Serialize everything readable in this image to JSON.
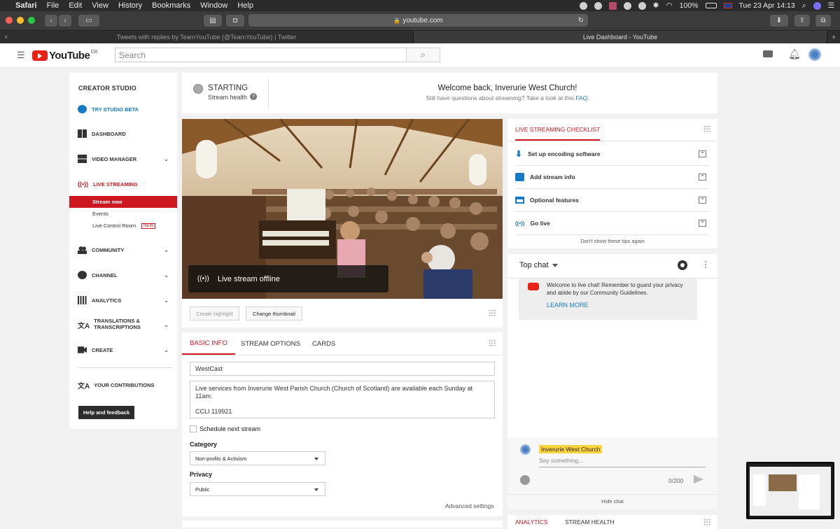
{
  "menubar": {
    "apple": "",
    "app": "Safari",
    "menus": [
      "File",
      "Edit",
      "View",
      "History",
      "Bookmarks",
      "Window",
      "Help"
    ],
    "battery": "100%",
    "datetime": "Tue 23 Apr  14:13"
  },
  "browser": {
    "url": "youtube.com",
    "tabs": [
      {
        "label": "Tweets with replies by TeamYouTube (@TeamYouTube) | Twitter",
        "active": false
      },
      {
        "label": "Live Dashboard - YouTube",
        "active": true
      }
    ]
  },
  "header": {
    "logo_text": "YouTube",
    "region": "GB",
    "search_placeholder": "Search"
  },
  "sidebar": {
    "title": "CREATOR STUDIO",
    "items": [
      {
        "label": "TRY STUDIO BETA",
        "icon": "gear-icon",
        "accent": true
      },
      {
        "label": "DASHBOARD",
        "icon": "dashboard-icon"
      },
      {
        "label": "VIDEO MANAGER",
        "icon": "video-manager-icon",
        "chevron": true
      },
      {
        "label": "LIVE STREAMING",
        "icon": "live-icon",
        "accent": true
      },
      {
        "label": "COMMUNITY",
        "icon": "community-icon",
        "chevron": true
      },
      {
        "label": "CHANNEL",
        "icon": "channel-icon",
        "chevron": true
      },
      {
        "label": "ANALYTICS",
        "icon": "analytics-icon",
        "chevron": true
      },
      {
        "label": "TRANSLATIONS &",
        "label2": "TRANSCRIPTIONS",
        "icon": "translate-icon",
        "chevron": true
      },
      {
        "label": "CREATE",
        "icon": "create-icon",
        "chevron": true
      },
      {
        "label": "YOUR CONTRIBUTIONS",
        "icon": "contributions-icon"
      }
    ],
    "subitems": [
      {
        "label": "Stream now",
        "active": true
      },
      {
        "label": "Events"
      },
      {
        "label": "Live Control Room",
        "badge": "NEW"
      }
    ],
    "help_label": "Help and feedback"
  },
  "status": {
    "state": "STARTING",
    "health_label": "Stream health",
    "welcome": "Welcome back, Inverurie West Church!",
    "faq_prefix": "Still have questions about streaming? Take a look at this",
    "faq_link": "FAQ",
    "faq_suffix": "."
  },
  "video": {
    "offline_label": "Live stream offline",
    "create_highlight": "Create highlight",
    "change_thumbnail": "Change thumbnail"
  },
  "info": {
    "tabs": [
      "BASIC INFO",
      "STREAM OPTIONS",
      "CARDS"
    ],
    "title_value": "WestCast",
    "description_line1": "Live services from Inverurie West Parish Church (Church of Scotland) are available each Sunday at",
    "description_line2": "11am.",
    "description_line3": "CCLI 119921",
    "schedule_label": "Schedule next stream",
    "category_label": "Category",
    "category_value": "Non-profits & Activism",
    "privacy_label": "Privacy",
    "privacy_value": "Public",
    "advanced_label": "Advanced settings"
  },
  "checklist": {
    "title": "LIVE STREAMING CHECKLIST",
    "items": [
      {
        "label": "Set up encoding software",
        "icon": "download-icon"
      },
      {
        "label": "Add stream info",
        "icon": "stream-info-icon"
      },
      {
        "label": "Optional features",
        "icon": "card-icon"
      },
      {
        "label": "Go live",
        "icon": "broadcast-icon"
      }
    ],
    "dismiss": "Don't show these tips again"
  },
  "chat": {
    "mode": "Top chat",
    "welcome_text": "Welcome to live chat! Remember to guard your privacy and abide by our Community Guidelines.",
    "learn_more": "LEARN MORE",
    "author": "Inverurie West Church",
    "input_placeholder": "Say something...",
    "counter": "0/200",
    "hide_label": "Hide chat"
  },
  "bottom": {
    "tabs": [
      "ANALYTICS",
      "STREAM HEALTH"
    ]
  },
  "colors": {
    "accent": "#cc181e",
    "link": "#167ac6",
    "highlight": "#ffd43b"
  }
}
